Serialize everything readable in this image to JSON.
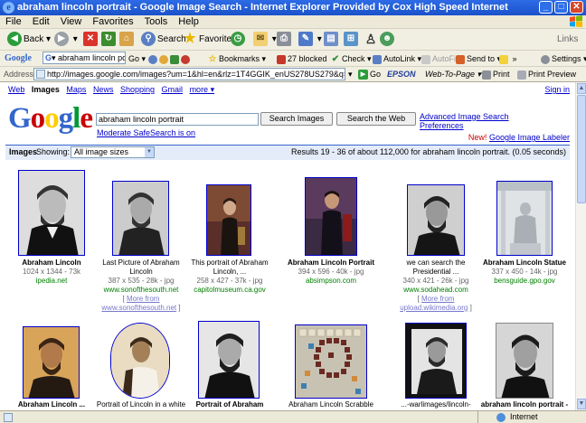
{
  "window": {
    "title": "abraham lincoln portrait - Google Image Search - Internet Explorer Provided by Cox High Speed Internet",
    "min_glyph": "_",
    "max_glyph": "□",
    "close_glyph": "✕"
  },
  "menu": [
    "File",
    "Edit",
    "View",
    "Favorites",
    "Tools",
    "Help"
  ],
  "toolbar": {
    "back": "Back",
    "search": "Search",
    "favorites": "Favorites",
    "links": "Links"
  },
  "google_toolbar": {
    "label": "Google",
    "query": "abraham lincoln portrait",
    "go": "Go",
    "bookmarks": "Bookmarks",
    "blocked": "27 blocked",
    "check": "Check",
    "autolink": "AutoLink",
    "autofill": "AutoFill",
    "sendto": "Send to",
    "settings": "Settings"
  },
  "address_bar": {
    "label": "Address",
    "url": "http://images.google.com/images?um=1&hl=en&rlz=1T4GGIK_enUS278US279&q=abraham+lincoln+port",
    "go": "Go",
    "epson": "EPSON",
    "web_to_page": "Web-To-Page",
    "print": "Print",
    "print_preview": "Print Preview"
  },
  "page": {
    "nav": [
      {
        "label": "Web",
        "active": false
      },
      {
        "label": "Images",
        "active": true
      },
      {
        "label": "Maps",
        "active": false
      },
      {
        "label": "News",
        "active": false
      },
      {
        "label": "Shopping",
        "active": false
      },
      {
        "label": "Gmail",
        "active": false
      },
      {
        "label": "more ▾",
        "active": false
      }
    ],
    "sign_in": "Sign in",
    "logo": "Google",
    "logo_colors": [
      "#3366cc",
      "#cc0000",
      "#ffcc00",
      "#3366cc",
      "#009933",
      "#cc0000"
    ],
    "query": "abraham lincoln portrait",
    "search_images_btn": "Search Images",
    "search_web_btn": "Search the Web",
    "advanced": "Advanced Image Search",
    "preferences": "Preferences",
    "safesearch": "Moderate SafeSearch is on",
    "new_badge": "New!",
    "labeler": "Google Image Labeler",
    "results_title": "Images",
    "showing": "Showing:",
    "size_filter": "All image sizes",
    "results_summary": "Results 19 - 36 of about 112,000 for abraham lincoln portrait. (0.05 seconds)"
  },
  "results": [
    {
      "title": "Abraham Lincoln",
      "dims": "1024 x 1344 - 73k",
      "url": "ipedia.net",
      "more": ""
    },
    {
      "title": "Last Picture of Abraham Lincoln",
      "dims": "387 x 535 - 28k - jpg",
      "url": "www.sonofthesouth.net",
      "more": "More from www.sonofthesouth.net"
    },
    {
      "title": "This portrait of Abraham Lincoln, ...",
      "dims": "258 x 427 - 37k - jpg",
      "url": "capitolmuseum.ca.gov",
      "more": ""
    },
    {
      "title": "Abraham Lincoln Portrait",
      "dims": "394 x 596 - 40k - jpg",
      "url": "absimpson.com",
      "more": ""
    },
    {
      "title": "we can search the Presidential ...",
      "dims": "340 x 421 - 26k - jpg",
      "url": "www.sodahead.com",
      "more": "More from upload.wikimedia.org"
    },
    {
      "title": "Abraham Lincoln Statue",
      "dims": "337 x 450 - 14k - jpg",
      "url": "bensguide.gpo.gov",
      "more": ""
    },
    {
      "title": "Abraham Lincoln ...",
      "dims": "",
      "url": "",
      "more": ""
    },
    {
      "title": "Portrait of Lincoln in a white",
      "dims": "",
      "url": "",
      "more": ""
    },
    {
      "title": "Portrait of Abraham",
      "dims": "",
      "url": "",
      "more": ""
    },
    {
      "title": "Abraham Lincoln Scrabble portrait",
      "dims": "",
      "url": "",
      "more": ""
    },
    {
      "title": "...-warlimages/lincoln-",
      "dims": "",
      "url": "",
      "more": ""
    },
    {
      "title": "abraham lincoln portrait -",
      "dims": "",
      "url": "",
      "more": ""
    }
  ],
  "status": {
    "zone": "Internet"
  }
}
